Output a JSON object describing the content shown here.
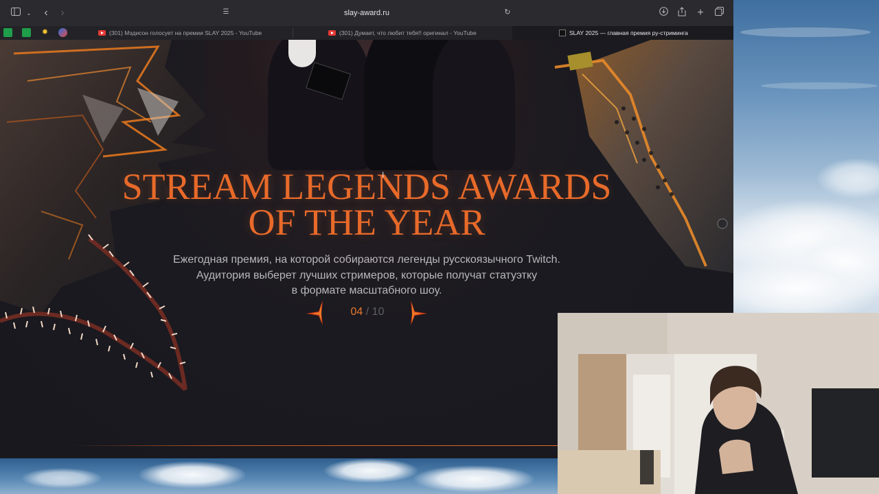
{
  "browser": {
    "url": "slay-award.ru",
    "tabs": [
      {
        "title": "(301) Мэдисон голосует на премии SLAY 2025 - YouTube",
        "active": false
      },
      {
        "title": "(301) Думает, что любит тебя!! оригинал - YouTube",
        "active": false
      },
      {
        "title": "SLAY 2025 — главная премия ру-стриминга",
        "active": true
      }
    ],
    "colors": {
      "toolbar": "#2b2b2f",
      "tabbar": "#232327"
    }
  },
  "hero": {
    "title_line1": "STREAM LEGENDS AWARDS",
    "title_line2": "OF THE YEAR",
    "description_line1": "Ежегодная премия, на которой собираются легенды русскоязычного Twitch.",
    "description_line2": "Аудитория выберет лучших стримеров, которые получат статуэтку",
    "description_line3": "в формате масштабного шоу.",
    "slide_current": "04",
    "slide_separator": " / ",
    "slide_total": "10",
    "accent_color": "#e86a2a"
  },
  "icons": {
    "sidebar": "sidebar-icon",
    "back": "chevron-left-icon",
    "forward": "chevron-right-icon",
    "download": "download-icon",
    "share": "share-icon",
    "new_tab": "plus-icon",
    "tabs_overview": "tabs-overview-icon",
    "reload": "reload-icon",
    "reader": "reader-icon"
  }
}
